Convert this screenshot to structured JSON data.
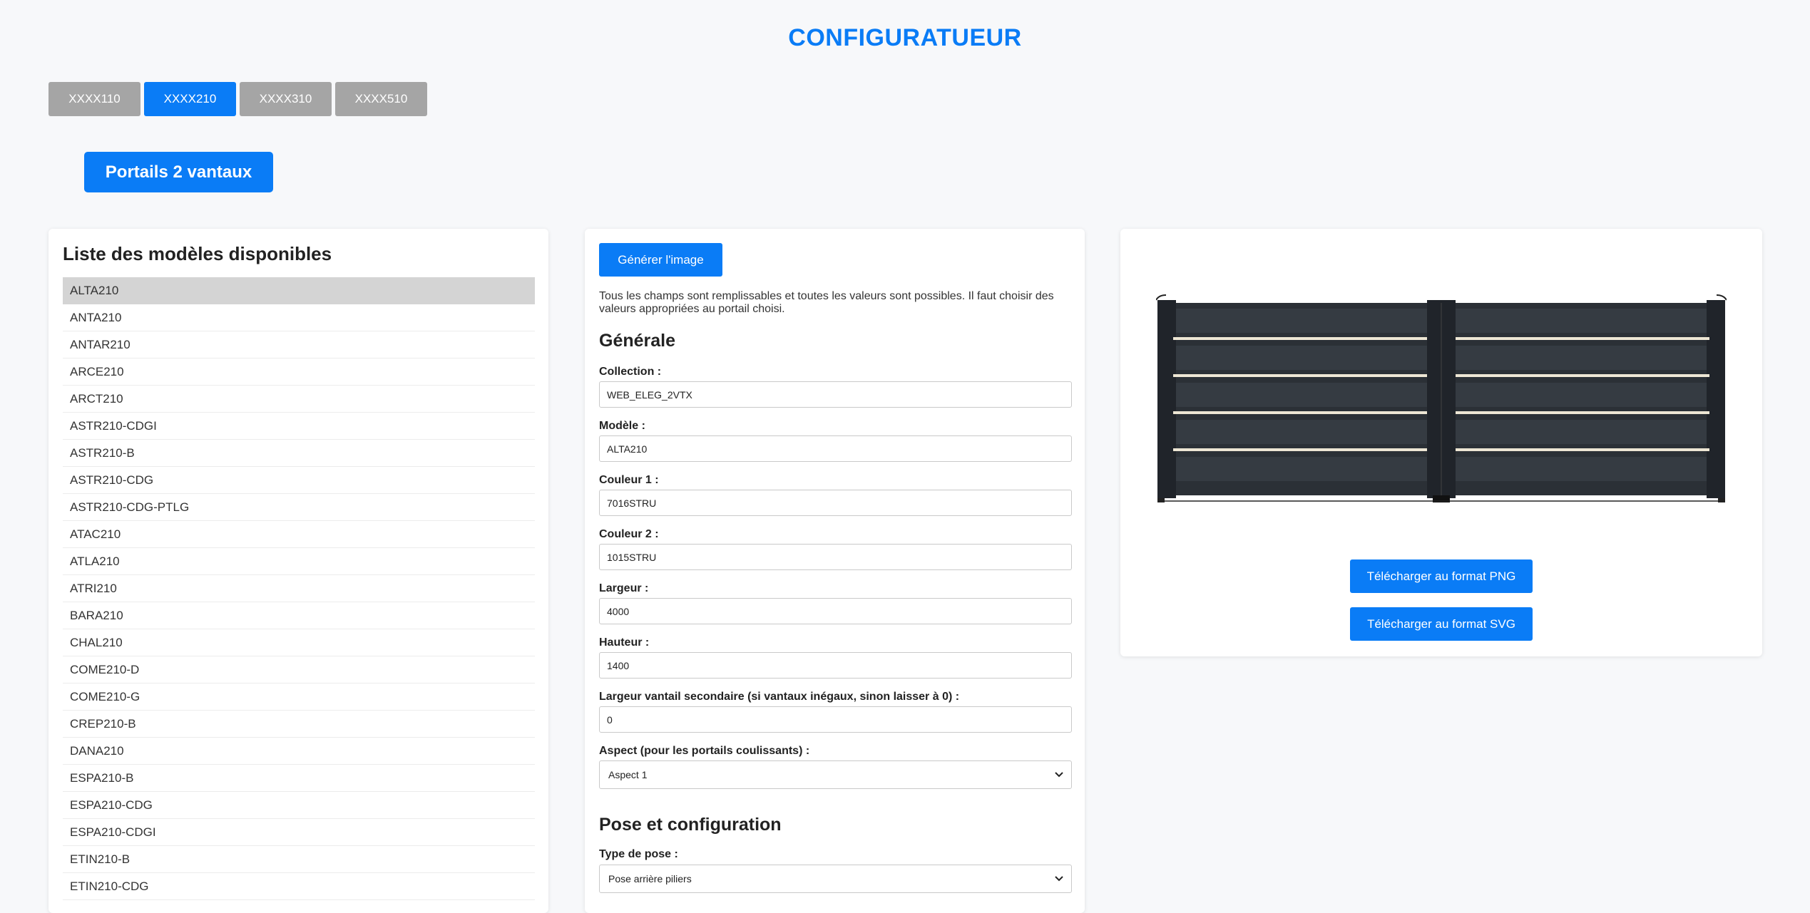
{
  "app": {
    "title": "CONFIGURATUEUR"
  },
  "tabs": [
    {
      "label": "XXXX110",
      "active": false
    },
    {
      "label": "XXXX210",
      "active": true
    },
    {
      "label": "XXXX310",
      "active": false
    },
    {
      "label": "XXXX510",
      "active": false
    }
  ],
  "family_button": "Portails 2 vantaux",
  "models": {
    "heading": "Liste des modèles disponibles",
    "selected": "ALTA210",
    "items": [
      "ALTA210",
      "ANTA210",
      "ANTAR210",
      "ARCE210",
      "ARCT210",
      "ASTR210-CDGI",
      "ASTR210-B",
      "ASTR210-CDG",
      "ASTR210-CDG-PTLG",
      "ATAC210",
      "ATLA210",
      "ATRI210",
      "BARA210",
      "CHAL210",
      "COME210-D",
      "COME210-G",
      "CREP210-B",
      "DANA210",
      "ESPA210-B",
      "ESPA210-CDG",
      "ESPA210-CDGI",
      "ETIN210-B",
      "ETIN210-CDG"
    ]
  },
  "form": {
    "generate_label": "Générer l'image",
    "info": "Tous les champs sont remplissables et toutes les valeurs sont possibles. Il faut choisir des valeurs appropriées au portail choisi.",
    "section_general": "Générale",
    "collection_label": "Collection :",
    "collection_value": "WEB_ELEG_2VTX",
    "modele_label": "Modèle :",
    "modele_value": "ALTA210",
    "couleur1_label": "Couleur 1 :",
    "couleur1_value": "7016STRU",
    "couleur2_label": "Couleur 2 :",
    "couleur2_value": "1015STRU",
    "largeur_label": "Largeur :",
    "largeur_value": "4000",
    "hauteur_label": "Hauteur :",
    "hauteur_value": "1400",
    "largeur_sec_label": "Largeur vantail secondaire (si vantaux inégaux, sinon laisser à 0) :",
    "largeur_sec_value": "0",
    "aspect_label": "Aspect (pour les portails coulissants) :",
    "aspect_value": "Aspect 1",
    "section_pose": "Pose et configuration",
    "type_pose_label": "Type de pose :",
    "type_pose_value": "Pose arrière piliers"
  },
  "preview": {
    "png_label": "Télécharger au format PNG",
    "svg_label": "Télécharger au format SVG",
    "colors": {
      "panel": "#2b3036",
      "panel_light": "#353b42",
      "frame": "#20242a",
      "stripe": "#ede6d4"
    }
  }
}
